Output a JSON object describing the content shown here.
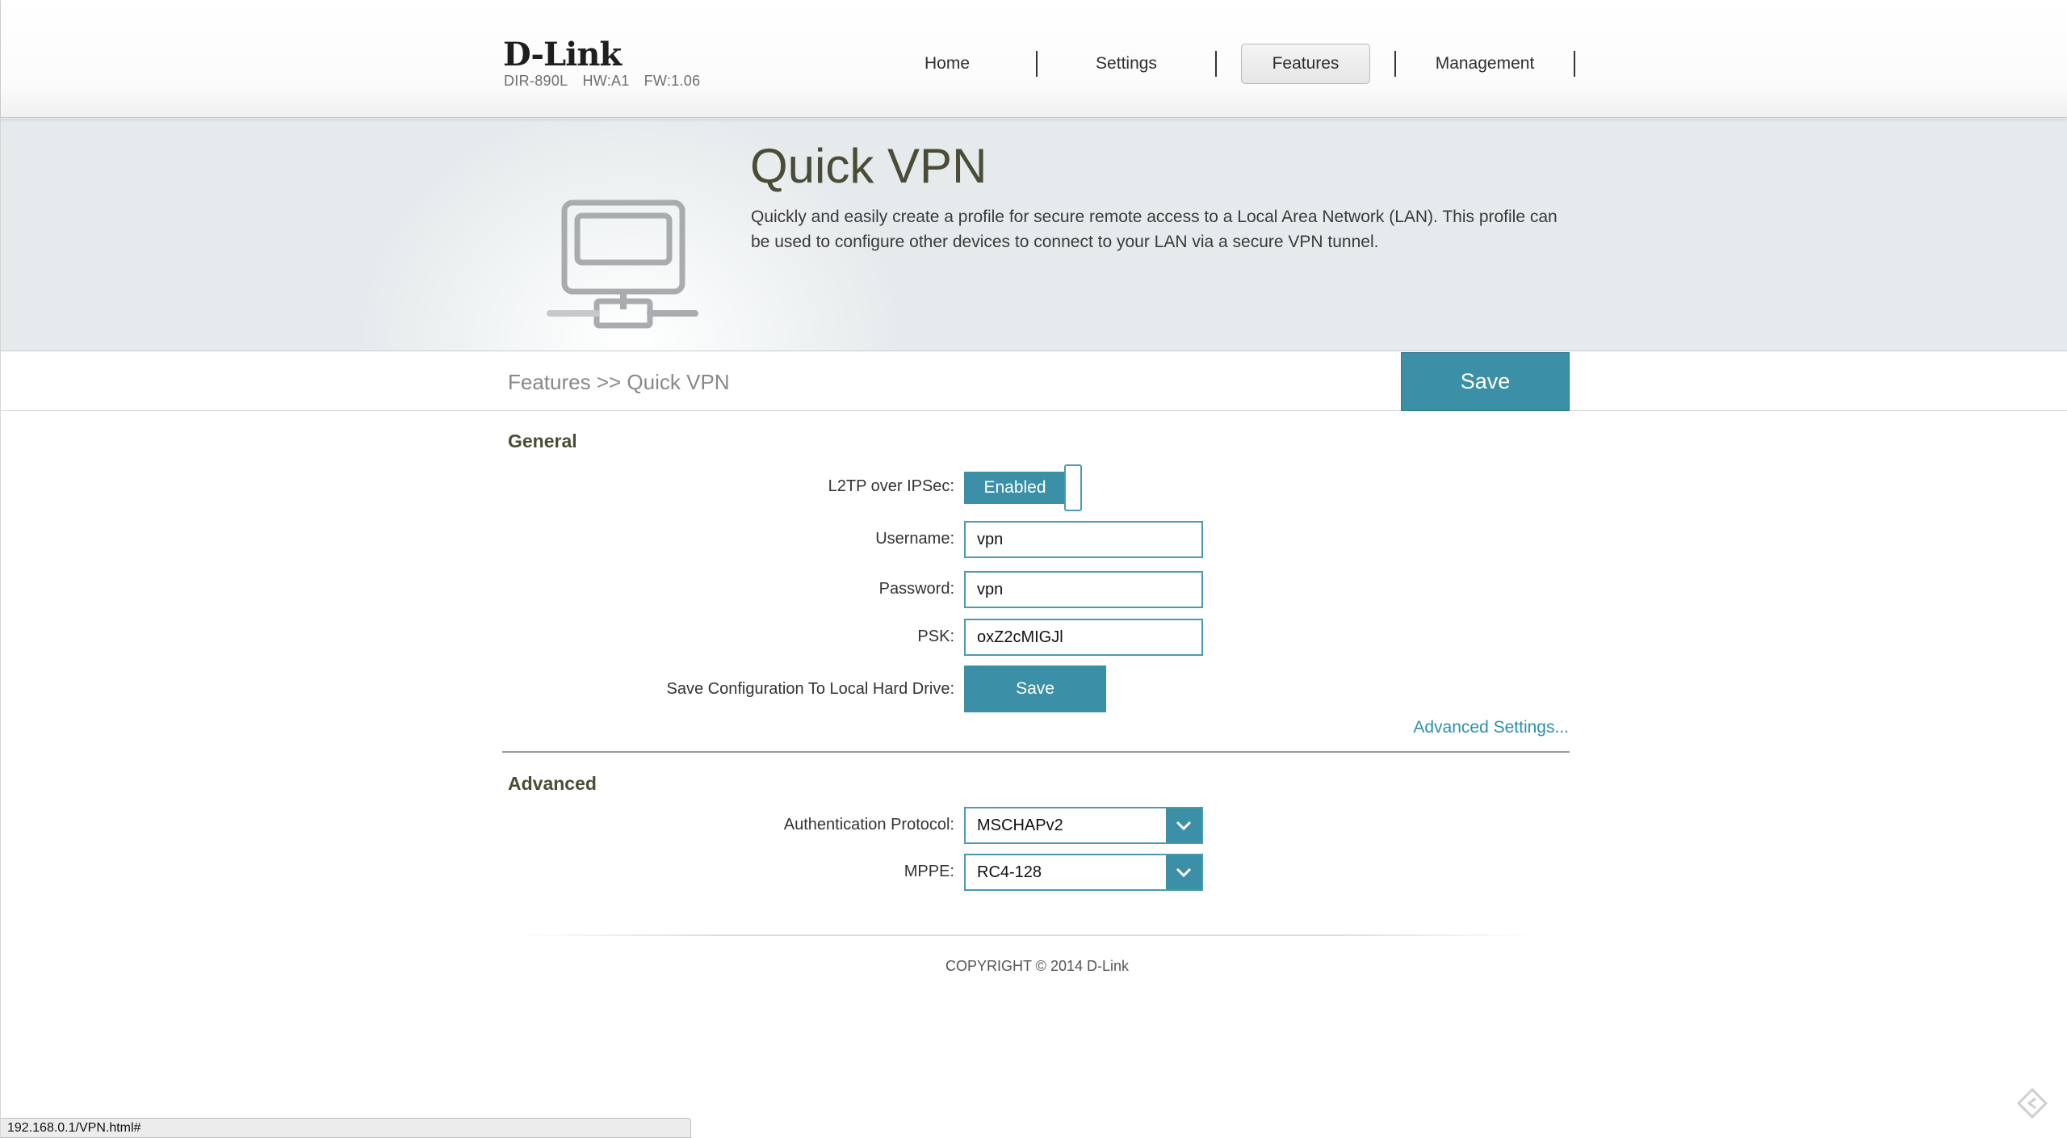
{
  "header": {
    "logo": "D-Link",
    "model": "DIR-890L",
    "hw": "HW:A1",
    "fw": "FW:1.06",
    "nav": [
      {
        "label": "Home"
      },
      {
        "label": "Settings"
      },
      {
        "label": "Features",
        "active": true
      },
      {
        "label": "Management"
      }
    ]
  },
  "banner": {
    "title": "Quick VPN",
    "description": "Quickly and easily create a profile for secure remote access to a Local Area Network (LAN). This profile can be used to configure other devices to connect to your LAN via a secure VPN tunnel.",
    "icon": "network-monitor-icon"
  },
  "breadcrumb": "Features >> Quick VPN",
  "save_button": "Save",
  "general": {
    "title": "General",
    "l2tp_label": "L2TP over IPSec:",
    "l2tp_state": "Enabled",
    "username_label": "Username:",
    "username_value": "vpn",
    "password_label": "Password:",
    "password_value": "vpn",
    "psk_label": "PSK:",
    "psk_value": "oxZ2cMIGJl",
    "save_config_label": "Save Configuration To Local Hard Drive:",
    "save_config_button": "Save",
    "advanced_link": "Advanced Settings..."
  },
  "advanced": {
    "title": "Advanced",
    "auth_label": "Authentication Protocol:",
    "auth_value": "MSCHAPv2",
    "mppe_label": "MPPE:",
    "mppe_value": "RC4-128"
  },
  "footer": {
    "copyright": "COPYRIGHT © 2014 D-Link"
  },
  "statusbar": {
    "url": "192.168.0.1/VPN.html#"
  },
  "colors": {
    "accent": "#3b8fa6",
    "title": "#4a4d36",
    "link": "#2b8fb0"
  }
}
